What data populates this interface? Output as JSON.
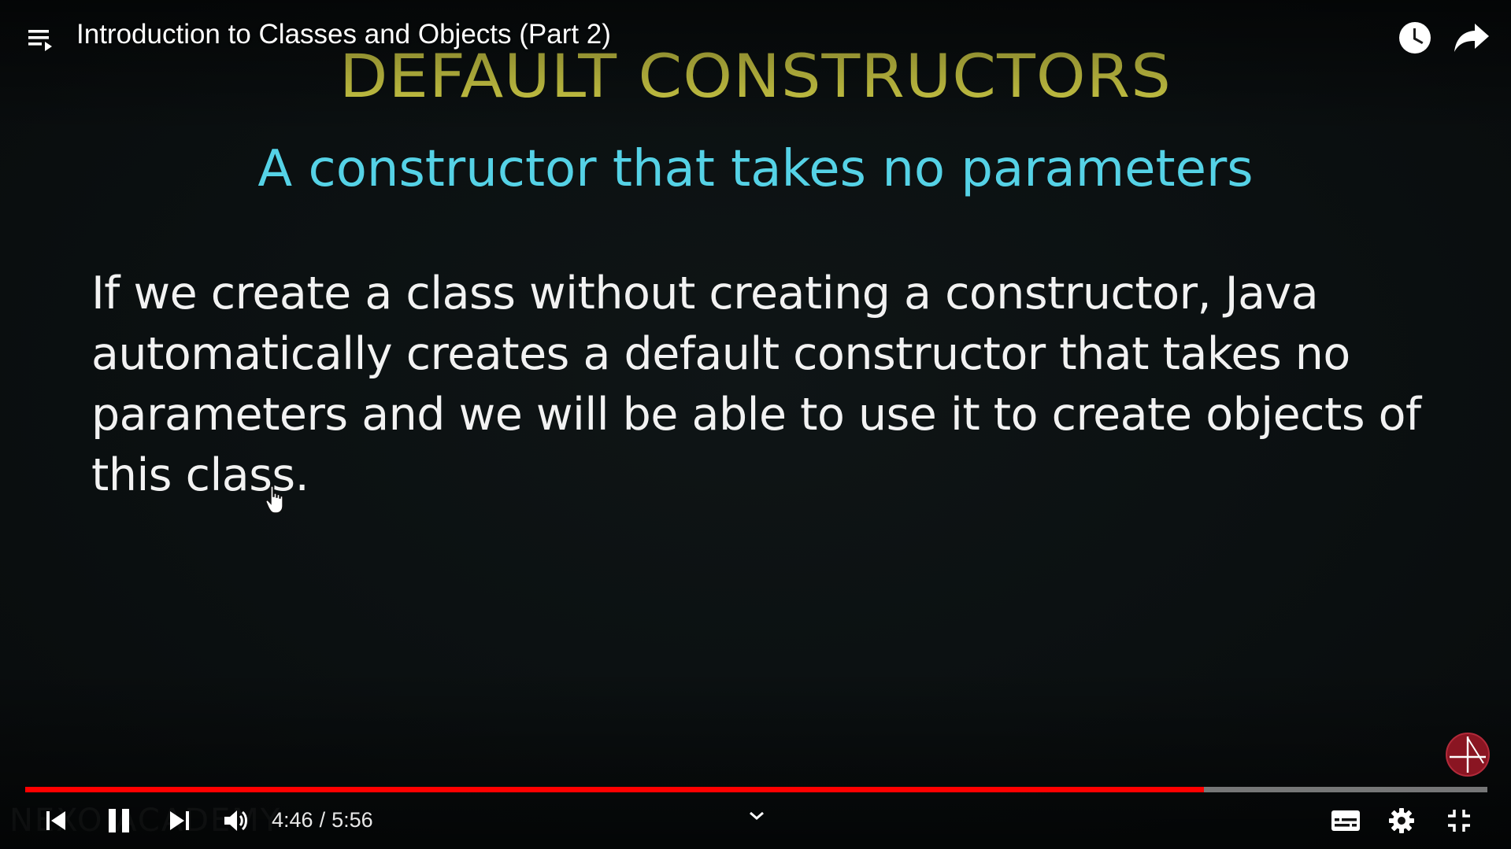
{
  "header": {
    "title": "Introduction to Classes and Objects (Part 2)",
    "playlist_icon": "playlist-icon",
    "watch_later_icon": "clock-icon",
    "share_icon": "share-arrow-icon"
  },
  "slide": {
    "heading": "DEFAULT CONSTRUCTORS",
    "subheading": "A constructor that takes no parameters",
    "body_lines": [
      "If we create a class without creating a constructor, Java",
      "automatically creates a default constructor that takes no",
      "parameters and we will be able to use it to create objects of",
      "this class."
    ],
    "watermark": "NEXO ACADEMY",
    "colors": {
      "heading": "#dcd94a",
      "subheading": "#55d2e6",
      "body": "#f2f2f2"
    }
  },
  "player": {
    "progress_fraction": 0.8061,
    "progress_color": "#ff0000",
    "time": {
      "current": "4:46",
      "separator": "/",
      "duration": "5:56"
    },
    "controls": {
      "previous_icon": "previous-icon",
      "pause_icon": "pause-icon",
      "next_icon": "next-icon",
      "volume_icon": "volume-icon",
      "chevron_icon": "chevron-down-icon",
      "captions_icon": "subtitles-icon",
      "settings_icon": "gear-icon",
      "exit_fullscreen_icon": "exit-fullscreen-icon"
    },
    "channel_logo_icon": "channel-logo-icon"
  }
}
